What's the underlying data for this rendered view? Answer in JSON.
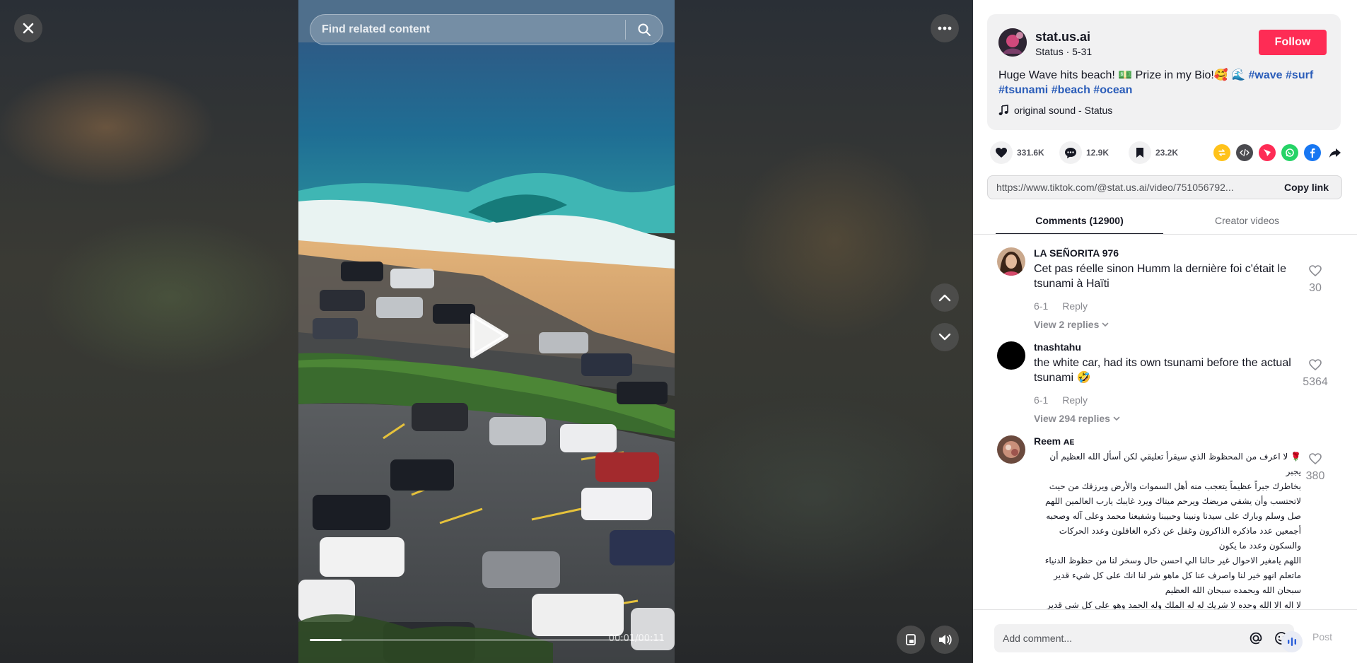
{
  "video": {
    "search_placeholder": "Find related content",
    "time": "00:01/00:11",
    "progress_fraction": 0.09
  },
  "author": {
    "username": "stat.us.ai",
    "subline": "Status · 5-31",
    "follow_label": "Follow"
  },
  "description": {
    "text": "Huge Wave hits beach! 💵 Prize in my Bio!🥰 🌊 ",
    "hashtags": [
      "#wave",
      "#surf",
      "#tsunami",
      "#beach",
      "#ocean"
    ]
  },
  "sound": {
    "label": "original sound - Status"
  },
  "actions": {
    "likes": "331.6K",
    "comments": "12.9K",
    "saves": "23.2K"
  },
  "share": {
    "link": "https://www.tiktok.com/@stat.us.ai/video/751056792...",
    "copy_label": "Copy link",
    "colors": {
      "repost": "#ffc21a",
      "embed": "#4a4a4f",
      "send": "#fe2c55",
      "whatsapp": "#25d366",
      "facebook": "#1877f2"
    }
  },
  "tabs": [
    {
      "label": "Comments (12900)",
      "active": true
    },
    {
      "label": "Creator videos",
      "active": false
    }
  ],
  "comments": [
    {
      "user": "LA SEÑORITA 976",
      "text": "Cet pas réelle sinon Humm la dernière foi c'était le tsunami à Haïti",
      "date": "6-1",
      "reply_label": "Reply",
      "view_replies": "View 2 replies",
      "likes": "30"
    },
    {
      "user": "tnashtahu",
      "text": "the white car, had its own tsunami before the actual tsunami 🤣",
      "date": "6-1",
      "reply_label": "Reply",
      "view_replies": "View 294 replies",
      "likes": "5364"
    },
    {
      "user": "Reem ᴀᴇ",
      "lines": [
        "🌹 لا اعرف من المحظوظ الذي سيقرأ تعليقي لكن أسأل الله العظيم أن يجبر",
        "بخاطرك جبراً عظيماً يتعجب منه أهل السموات والأرض ويرزقك من حيث",
        "لاتحتسب وأن يشفي مريضك ويرحم ميتاك ويرد غايبك يارب العالمين اللهم",
        "صل وسلم وبارك على سيدنا ونبينا وحبيبنا وشفيعنا محمد وعلى آله وصحبه",
        "أجمعين عدد ماذكره الذاكرون وغفل عن ذكره الغافلون وعدد الحركات",
        "والسكون وعدد ما يكون",
        "اللهم يامغير الاحوال غير حالنا الي احسن حال وسخر لنا من حظوظ الدنياء",
        "ماتعلم انهو خير لنا واصرف عنا كل ماهو شر لنا انك على كل شيء قدير",
        "سبحان الله وبحمده سبحان الله العظيم",
        "لا اله الا الله وحده لا شريك له له الملك وله الحمد وهو على كل شي قدير"
      ],
      "likes": "380"
    }
  ],
  "comment_bar": {
    "placeholder": "Add comment...",
    "post_label": "Post"
  }
}
